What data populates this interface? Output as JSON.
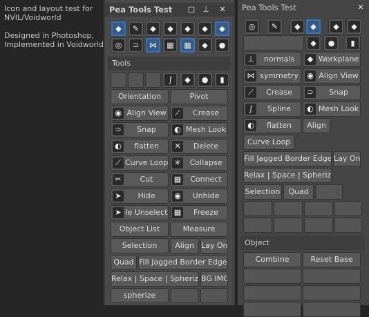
{
  "intro": {
    "line1": "Icon and layout test for",
    "line2": "NVIL/Voidworld",
    "line3": "Designed in Photoshop,",
    "line4": "Implemented in Voidworld"
  },
  "panel1": {
    "title": "Pea Tools Test",
    "section_tools": "Tools",
    "orientation": "Orientation",
    "pivot": "Pivot",
    "align_view": "Align View",
    "crease": "Crease",
    "snap": "Snap",
    "mesh_look": "Mesh Look",
    "flatten": "flatten",
    "delete": "Delete",
    "curve_loop": "Curve Loop",
    "collapse": "Collapse",
    "cut": "Cut",
    "connect": "Connect",
    "hide": "Hide",
    "unhide": "Unhide",
    "unselect": "le Unselect",
    "freeze": "Freeze",
    "object_list": "Object List",
    "measure": "Measure",
    "selection": "Selection",
    "align": "Align",
    "lay_on": "Lay On",
    "quad": "Quad",
    "fill_jagged": "Fill Jagged Border Edges",
    "relax": "Relax | Space | Spherize",
    "bg_img": "BG IMG",
    "spherize": "spherize"
  },
  "panel2": {
    "title": "Pea Tools Test",
    "normals": "normals",
    "workplane": "Workplane",
    "symmetry": "symmetry",
    "align_view": "Align View",
    "crease": "Crease",
    "snap": "Snap",
    "spline": "Spline",
    "mesh_look": "Mesh Look",
    "flatten": "flatten",
    "align": "Align",
    "curve_loop": "Curve Loop",
    "fill_jagged": "Fill Jagged Border Edges",
    "lay_on": "Lay On",
    "relax": "Relax | Space | Spherize",
    "selection": "Selection",
    "quad": "Quad",
    "section_object": "Object",
    "combine": "Combine",
    "reset_base": "Reset Base"
  },
  "icons": {
    "square": "□",
    "pin": "⊥",
    "close": "✕",
    "cube": "◆",
    "brush": "✎",
    "target": "◎",
    "magnet": "⊃",
    "mirror": "⋈",
    "grid": "▦",
    "bulb": "●",
    "eye": "◉",
    "crease": "⟋",
    "halfcircle": "◐",
    "x": "✕",
    "star": "✳",
    "knife": "✂",
    "sphere": "●",
    "cylinder": "▮",
    "arrow": "➤",
    "s": "∫"
  }
}
